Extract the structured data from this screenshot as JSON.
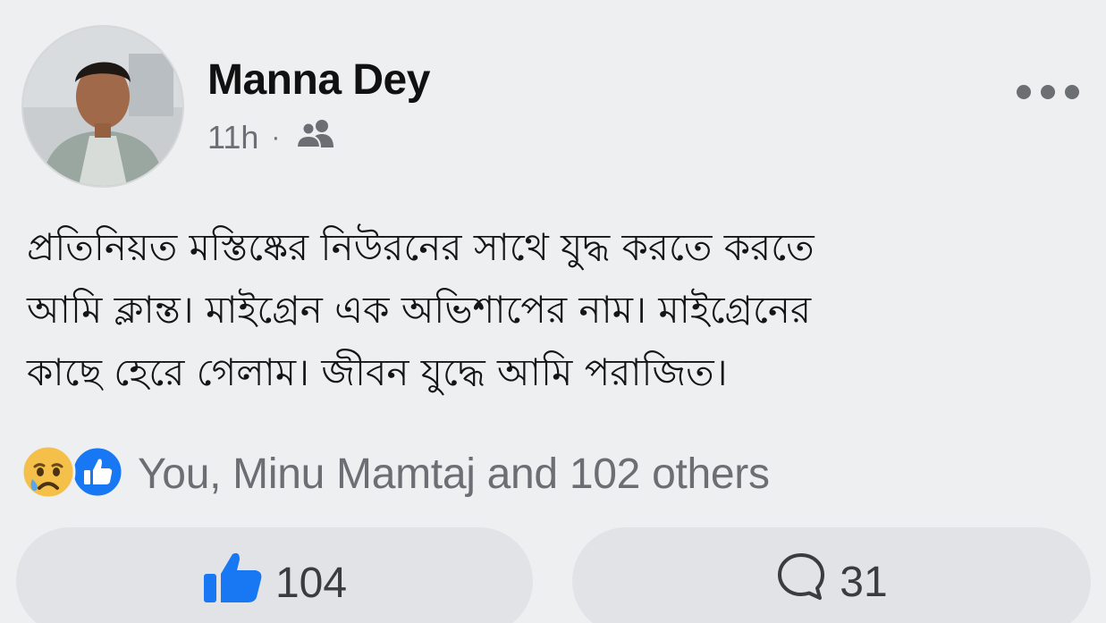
{
  "post": {
    "author": "Manna Dey",
    "time": "11h",
    "separator": "·",
    "audience_icon": "friends-icon",
    "more_icon": "more-options-icon",
    "text_lines": [
      "প্রতিনিয়ত মস্তিষ্কের নিউরনের সাথে যুদ্ধ  করতে করতে",
      "আমি ক্লান্ত। মাইগ্রেন এক অভিশাপের নাম। মাইগ্রেনের",
      "কাছে হেরে গেলাম। জীবন যুদ্ধে আমি পরাজিত।"
    ]
  },
  "reactions": {
    "icons": [
      "sad-reaction-icon",
      "like-reaction-icon"
    ],
    "summary": "You, Minu Mamtaj and 102 others"
  },
  "actions": {
    "like_count": "104",
    "comment_count": "31"
  },
  "colors": {
    "background": "#eeeff1",
    "button_bg": "#e1e3e6",
    "facebook_blue": "#1877f2",
    "muted_text": "#6b6e73"
  }
}
